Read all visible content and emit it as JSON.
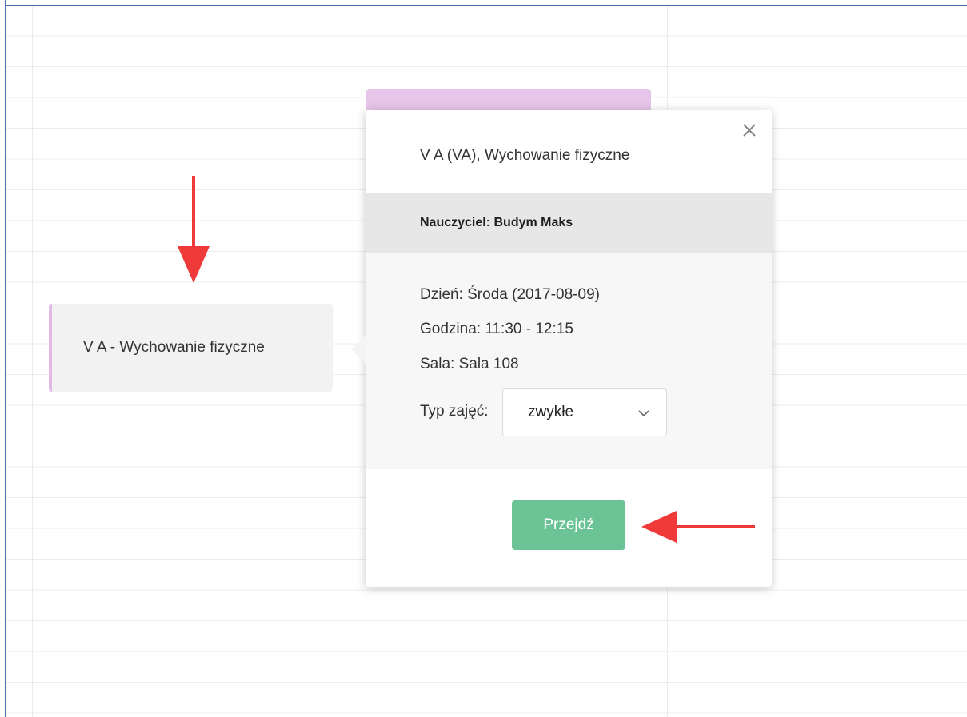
{
  "calendar": {
    "event_card": {
      "label": "V A - Wychowanie fizyczne",
      "accent_color": "#e3b9e8"
    }
  },
  "popup": {
    "title": "V A (VA), Wychowanie fizyczne",
    "teacher": "Nauczyciel: Budym Maks",
    "details": {
      "day": "Dzień: Środa (2017-08-09)",
      "time": "Godzina: 11:30 - 12:15",
      "room": "Sala: Sala 108"
    },
    "lesson_type": {
      "label": "Typ zajęć:",
      "selected": "zwykłe"
    },
    "go_button_label": "Przejdź",
    "go_button_color": "#6cc496"
  },
  "annotations": {
    "arrow_color": "#f03a3a"
  }
}
